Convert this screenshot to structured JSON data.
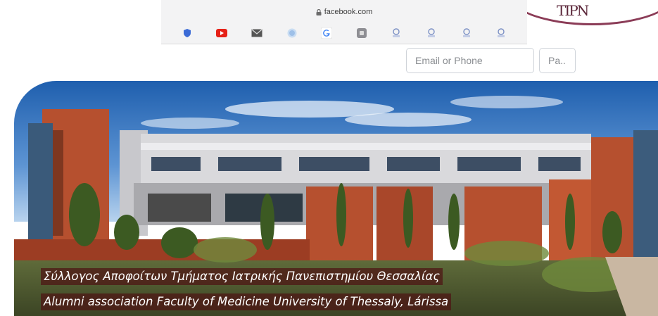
{
  "browser": {
    "url": "facebook.com",
    "bookmarks": [
      {
        "icon": "shield-icon",
        "color": "#3b6bd6"
      },
      {
        "icon": "youtube-icon",
        "color": "#e62117"
      },
      {
        "icon": "mail-icon",
        "color": "#555555"
      },
      {
        "icon": "globe-icon",
        "color": "#9ec0e8"
      },
      {
        "icon": "google-icon",
        "color": "#4285f4"
      },
      {
        "icon": "g-square-icon",
        "color": "#8e8e93"
      },
      {
        "icon": "bookmark-site-icon",
        "color": "#7a8fc4"
      },
      {
        "icon": "bookmark-site-icon",
        "color": "#7a8fc4"
      },
      {
        "icon": "bookmark-site-icon",
        "color": "#7a8fc4"
      },
      {
        "icon": "bookmark-site-icon",
        "color": "#7a8fc4"
      }
    ]
  },
  "login": {
    "email_placeholder": "Email or Phone",
    "password_placeholder": "Pa..."
  },
  "banner": {
    "caption_greek": "Σύλλογος Αποφοίτων Τμήματος Ιατρικής Πανεπιστημίου Θεσσαλίας",
    "caption_english": "Alumni association Faculty of Medicine University of Thessaly, Lárissa",
    "caption_bg": "#4e1414",
    "brick_color": "#b6502f",
    "sky_color": "#2f6fb8"
  }
}
